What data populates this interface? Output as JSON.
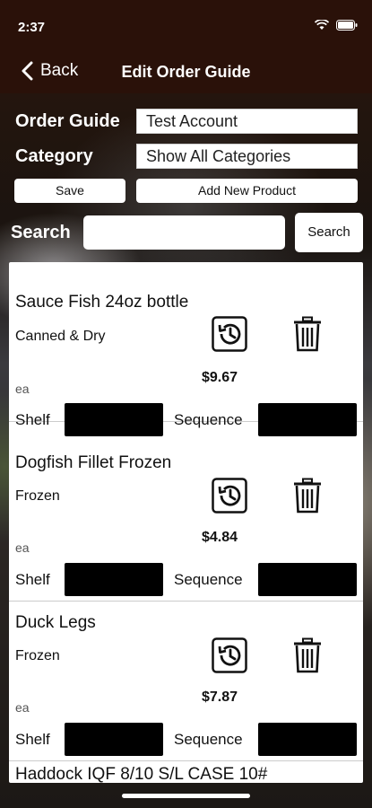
{
  "status_bar": {
    "time": "2:37"
  },
  "nav": {
    "back_label": "Back",
    "title": "Edit Order Guide"
  },
  "form": {
    "order_guide_label": "Order Guide",
    "order_guide_value": "Test Account",
    "category_label": "Category",
    "category_value": "Show All Categories",
    "save_label": "Save",
    "add_product_label": "Add New Product"
  },
  "search": {
    "label": "Search",
    "input_value": "",
    "button_label": "Search"
  },
  "products": [
    {
      "name": "Sauce Fish 24oz bottle",
      "category": "Canned & Dry",
      "unit": "ea",
      "price": "$9.67",
      "shelf_label": "Shelf",
      "sequence_label": "Sequence"
    },
    {
      "name": "Dogfish Fillet Frozen",
      "category": "Frozen",
      "unit": "ea",
      "price": "$4.84",
      "shelf_label": "Shelf",
      "sequence_label": "Sequence"
    },
    {
      "name": "Duck Legs",
      "category": "Frozen",
      "unit": "ea",
      "price": "$7.87",
      "shelf_label": "Shelf",
      "sequence_label": "Sequence"
    }
  ],
  "peek_item": "Haddock IQF 8/10 S/L CASE 10#",
  "icons": [
    "chevron-left-icon",
    "history-icon",
    "trash-icon",
    "location-icon",
    "wifi-icon",
    "battery-icon"
  ],
  "colors": {
    "header": "#2a1109",
    "field_fill": "#000000"
  }
}
